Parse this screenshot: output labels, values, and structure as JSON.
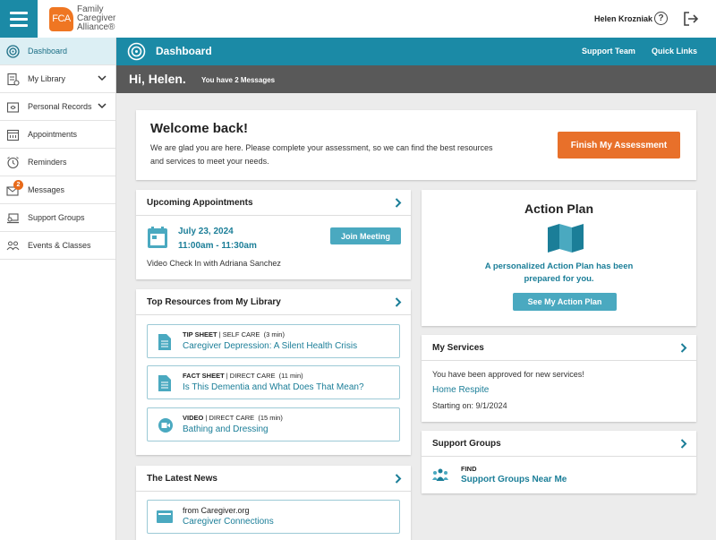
{
  "header": {
    "logo_mark": "FCA",
    "logo_lines": [
      "Family",
      "Caregiver",
      "Alliance®"
    ],
    "user_name": "Helen Krozniak",
    "help_glyph": "?"
  },
  "sidebar": {
    "items": [
      {
        "label": "Dashboard",
        "icon": "dashboard-icon",
        "active": true
      },
      {
        "label": "My Library",
        "icon": "library-icon",
        "expandable": true
      },
      {
        "label": "Personal Records",
        "icon": "records-icon",
        "expandable": true
      },
      {
        "label": "Appointments",
        "icon": "calendar-icon"
      },
      {
        "label": "Reminders",
        "icon": "alarm-icon"
      },
      {
        "label": "Messages",
        "icon": "envelope-icon",
        "badge": "2"
      },
      {
        "label": "Support Groups",
        "icon": "laptop-icon"
      },
      {
        "label": "Events & Classes",
        "icon": "people-icon"
      }
    ]
  },
  "mainbar": {
    "title": "Dashboard",
    "support_team": "Support Team",
    "quick_links": "Quick Links"
  },
  "greeting": {
    "hi": "Hi, Helen.",
    "messages": "You have 2 Messages"
  },
  "welcome": {
    "title": "Welcome back!",
    "text": "We are glad you are here. Please complete your assessment, so we can find the best resources and services to meet your needs.",
    "button": "Finish My Assessment"
  },
  "appointments": {
    "title": "Upcoming Appointments",
    "date": "July 23, 2024",
    "time": "11:00am - 11:30am",
    "description": "Video Check In with Adriana Sanchez",
    "join_button": "Join Meeting"
  },
  "resources": {
    "title": "Top Resources from My Library",
    "items": [
      {
        "type": "TIP SHEET",
        "category": "SELF CARE",
        "duration": "(3 min)",
        "title": "Caregiver Depression: A Silent Health Crisis",
        "icon": "document-icon"
      },
      {
        "type": "FACT SHEET",
        "category": "DIRECT CARE",
        "duration": "(11 min)",
        "title": "Is This Dementia and What Does That Mean?",
        "icon": "document-icon"
      },
      {
        "type": "VIDEO",
        "category": "DIRECT CARE",
        "duration": "(15 min)",
        "title": "Bathing and Dressing",
        "icon": "video-icon"
      }
    ]
  },
  "news": {
    "title": "The Latest News",
    "from": "from Caregiver.org",
    "link": "Caregiver Connections"
  },
  "action_plan": {
    "title": "Action Plan",
    "description_line1": "A personalized Action Plan has been",
    "description_line2": "prepared for you.",
    "button": "See My Action Plan"
  },
  "services": {
    "title": "My Services",
    "approved": "You have been approved for new services!",
    "service": "Home Respite",
    "starting_label": "Starting on:",
    "starting_date": "9/1/2024"
  },
  "support_groups": {
    "title": "Support Groups",
    "find": "FIND",
    "link": "Support Groups Near Me"
  },
  "colors": {
    "teal": "#1b8aa6",
    "orange": "#e8702a",
    "dark_gray": "#595959",
    "link_teal": "#1b7e98"
  }
}
